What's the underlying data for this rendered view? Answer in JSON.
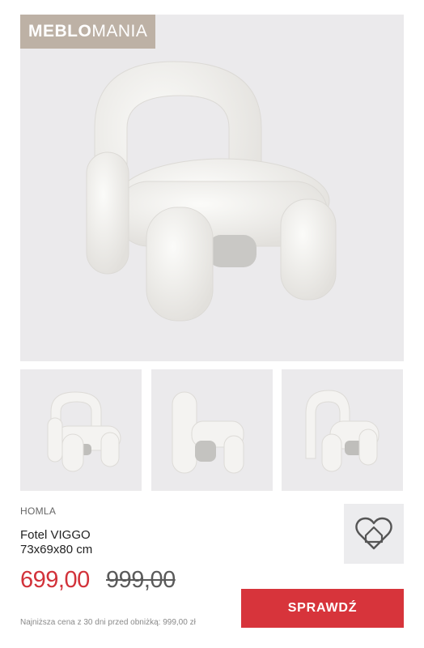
{
  "logo": {
    "bold": "MEBLO",
    "light": "MANIA"
  },
  "product": {
    "brand": "HOMLA",
    "name_line1": "Fotel VIGGO",
    "name_line2": "73x69x80 cm",
    "price_current": "699,00",
    "price_old": "999,00",
    "lowest_price_note": "Najniższa cena z 30 dni przed obniżką: 999,00 zł"
  },
  "cta": {
    "label": "SPRAWDŹ"
  },
  "icons": {
    "favorite": "heart-house-icon"
  },
  "colors": {
    "accent": "#d7343b",
    "price_current": "#d2323a",
    "logo_background": "#bdb1a5",
    "image_background": "#ebeaec"
  }
}
